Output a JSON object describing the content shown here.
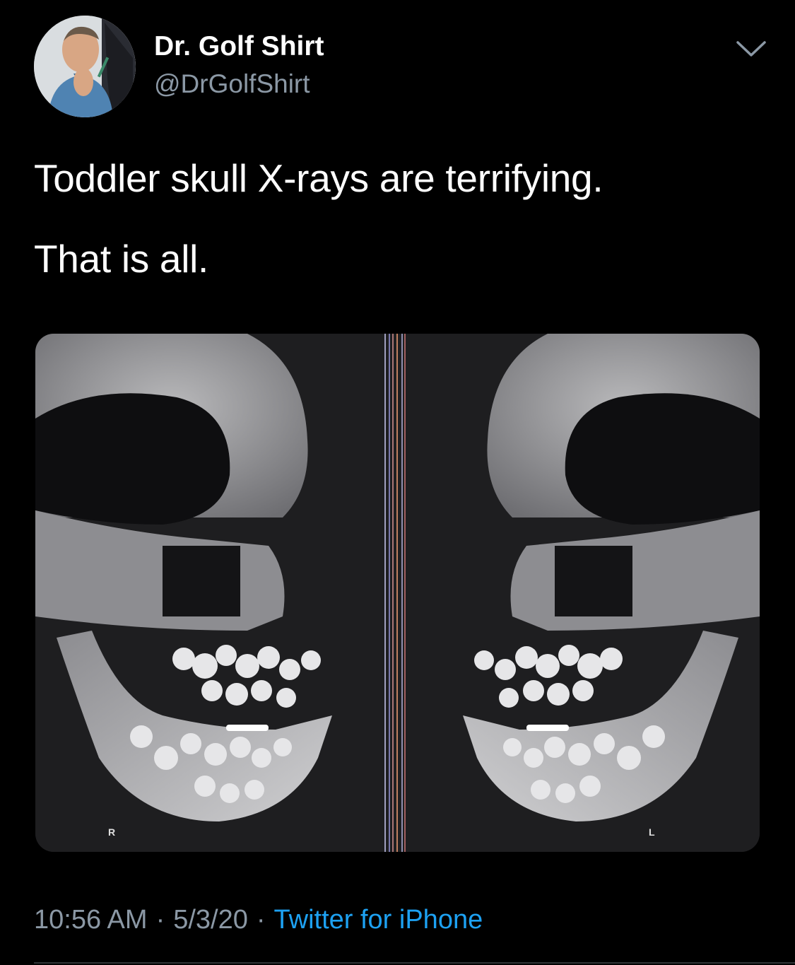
{
  "tweet": {
    "author": {
      "display_name": "Dr. Golf Shirt",
      "handle": "@DrGolfShirt",
      "avatar_icon": "profile-photo"
    },
    "menu_icon": "chevron-down-icon",
    "text_lines": [
      "Toddler skull X-rays are terrifying.",
      "That is all."
    ],
    "media": {
      "left_marker": "R",
      "right_marker": "L"
    },
    "meta": {
      "time": "10:56 AM",
      "separator": "·",
      "date": "5/3/20",
      "source": "Twitter for iPhone"
    }
  },
  "colors": {
    "background": "#000000",
    "primary_text": "#ffffff",
    "secondary_text": "#8b98a5",
    "link": "#1da1f2"
  }
}
